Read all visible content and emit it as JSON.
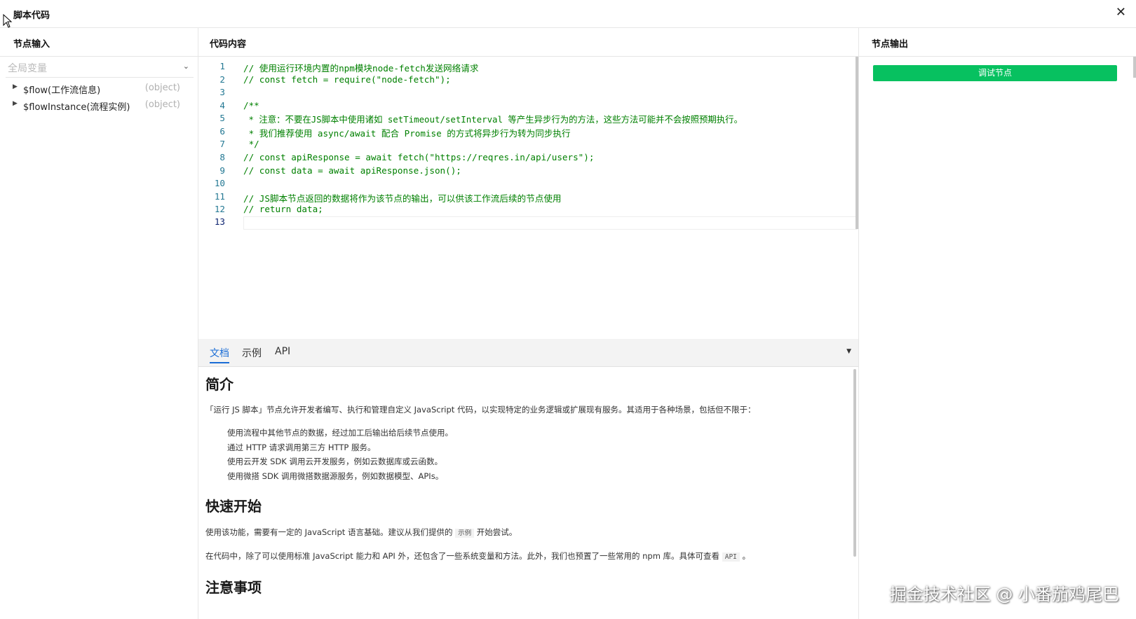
{
  "window": {
    "title": "脚本代码",
    "close_icon": "✕"
  },
  "left_panel": {
    "header": "节点输入",
    "scope_label": "全局变量",
    "variables": [
      {
        "name": "$flow(工作流信息)",
        "type": "(object)"
      },
      {
        "name": "$flowInstance(流程实例)",
        "type": "(object)"
      }
    ]
  },
  "middle_panel": {
    "header": "代码内容",
    "code_lines": [
      {
        "num": "1",
        "text": "// 使用运行环境内置的npm模块node-fetch发送网络请求"
      },
      {
        "num": "2",
        "text": "// const fetch = require(\"node-fetch\");"
      },
      {
        "num": "3",
        "text": ""
      },
      {
        "num": "4",
        "text": "/**"
      },
      {
        "num": "5",
        "text": " * 注意：不要在JS脚本中使用诸如 setTimeout/setInterval 等产生异步行为的方法，这些方法可能并不会按照预期执行。"
      },
      {
        "num": "6",
        "text": " * 我们推荐使用 async/await 配合 Promise 的方式将异步行为转为同步执行"
      },
      {
        "num": "7",
        "text": " */"
      },
      {
        "num": "8",
        "text": "// const apiResponse = await fetch(\"https://reqres.in/api/users\");"
      },
      {
        "num": "9",
        "text": "// const data = await apiResponse.json();"
      },
      {
        "num": "10",
        "text": ""
      },
      {
        "num": "11",
        "text": "// JS脚本节点返回的数据将作为该节点的输出，可以供该工作流后续的节点使用"
      },
      {
        "num": "12",
        "text": "// return data;"
      },
      {
        "num": "13",
        "text": ""
      }
    ],
    "doc_tabs": [
      "文档",
      "示例",
      "API"
    ],
    "doc": {
      "h_intro": "简介",
      "intro": "「运行 JS 脚本」节点允许开发者编写、执行和管理自定义 JavaScript 代码，以实现特定的业务逻辑或扩展现有服务。其适用于各种场景，包括但不限于：",
      "list": [
        "使用流程中其他节点的数据，经过加工后输出给后续节点使用。",
        "通过 HTTP 请求调用第三方 HTTP 服务。",
        "使用云开发 SDK 调用云开发服务，例如云数据库或云函数。",
        "使用微搭 SDK 调用微搭数据源服务，例如数据模型、APIs。"
      ],
      "h_quick": "快速开始",
      "quick_1_pre": "使用该功能，需要有一定的 JavaScript 语言基础。建议从我们提供的 ",
      "quick_1_code": "示例",
      "quick_1_post": " 开始尝试。",
      "quick_2_pre": "在代码中，除了可以使用标准 JavaScript 能力和 API 外，还包含了一些系统变量和方法。此外，我们也预置了一些常用的 npm 库。具体可查看 ",
      "quick_2_code": "API",
      "quick_2_post": " 。",
      "h_notes": "注意事项"
    }
  },
  "right_panel": {
    "header": "节点输出",
    "debug_button": "调试节点"
  },
  "watermark": "掘金技术社区 @ 小番茄鸡尾巴",
  "colors": {
    "accent_green": "#07c160",
    "tab_blue": "#1a6dd6",
    "comment_green": "#008000"
  }
}
